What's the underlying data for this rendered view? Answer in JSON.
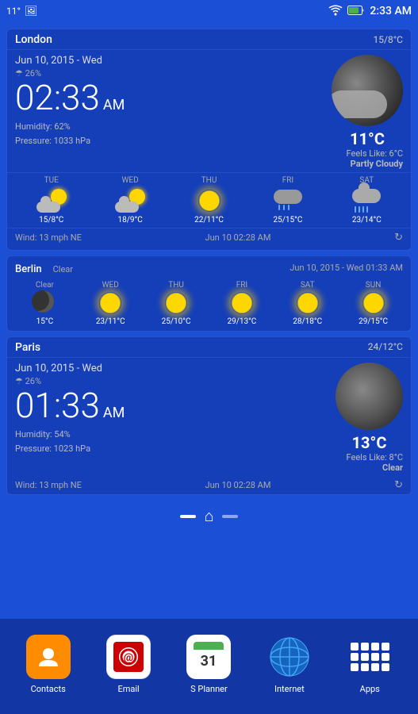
{
  "statusBar": {
    "leftIcons": "11°",
    "time": "2:33 AM",
    "batteryIcon": "🔋",
    "wifiIcon": "📶"
  },
  "london": {
    "city": "London",
    "tempRange": "15/8°C",
    "date": "Jun 10, 2015 - Wed",
    "rainChance": "☂ 26%",
    "time": "02:33",
    "ampm": "AM",
    "humidity": "Humidity: 62%",
    "pressure": "Pressure: 1033 hPa",
    "temp": "11°C",
    "feelsLike": "Feels Like: 6°C",
    "condition": "Partly Cloudy",
    "wind": "Wind: 13 mph NE",
    "updated": "Jun 10  02:28 AM",
    "forecast": [
      {
        "day": "TUE",
        "temp": "15/8°C",
        "icon": "sun-cloud"
      },
      {
        "day": "WED",
        "temp": "18/9°C",
        "icon": "sun-cloud"
      },
      {
        "day": "THU",
        "temp": "22/11°C",
        "icon": "sun"
      },
      {
        "day": "FRI",
        "temp": "25/15°C",
        "icon": "cloud"
      },
      {
        "day": "SAT",
        "temp": "23/14°C",
        "icon": "rain"
      }
    ]
  },
  "berlin": {
    "city": "Berlin",
    "condition": "Clear",
    "date": "Jun 10, 2015 - Wed 01:33 AM",
    "forecast": [
      {
        "day": "Clear",
        "temp": "15°C",
        "icon": "moon"
      },
      {
        "day": "WED",
        "temp": "23/11°C",
        "icon": "sun"
      },
      {
        "day": "THU",
        "temp": "25/10°C",
        "icon": "sun"
      },
      {
        "day": "FRI",
        "temp": "29/13°C",
        "icon": "sun"
      },
      {
        "day": "SAT",
        "temp": "28/18°C",
        "icon": "sun"
      },
      {
        "day": "SUN",
        "temp": "29/15°C",
        "icon": "sun"
      }
    ]
  },
  "paris": {
    "city": "Paris",
    "tempRange": "24/12°C",
    "date": "Jun 10, 2015 - Wed",
    "rainChance": "☂ 26%",
    "time": "01:33",
    "ampm": "AM",
    "humidity": "Humidity: 54%",
    "pressure": "Pressure: 1023 hPa",
    "temp": "13°C",
    "feelsLike": "Feels Like: 8°C",
    "condition": "Clear",
    "wind": "Wind: 13 mph NE",
    "updated": "Jun 10  02:28 AM"
  },
  "dock": {
    "items": [
      {
        "label": "Contacts",
        "id": "contacts"
      },
      {
        "label": "Email",
        "id": "email"
      },
      {
        "label": "S Planner",
        "id": "splanner"
      },
      {
        "label": "Internet",
        "id": "internet"
      },
      {
        "label": "Apps",
        "id": "apps"
      }
    ]
  }
}
